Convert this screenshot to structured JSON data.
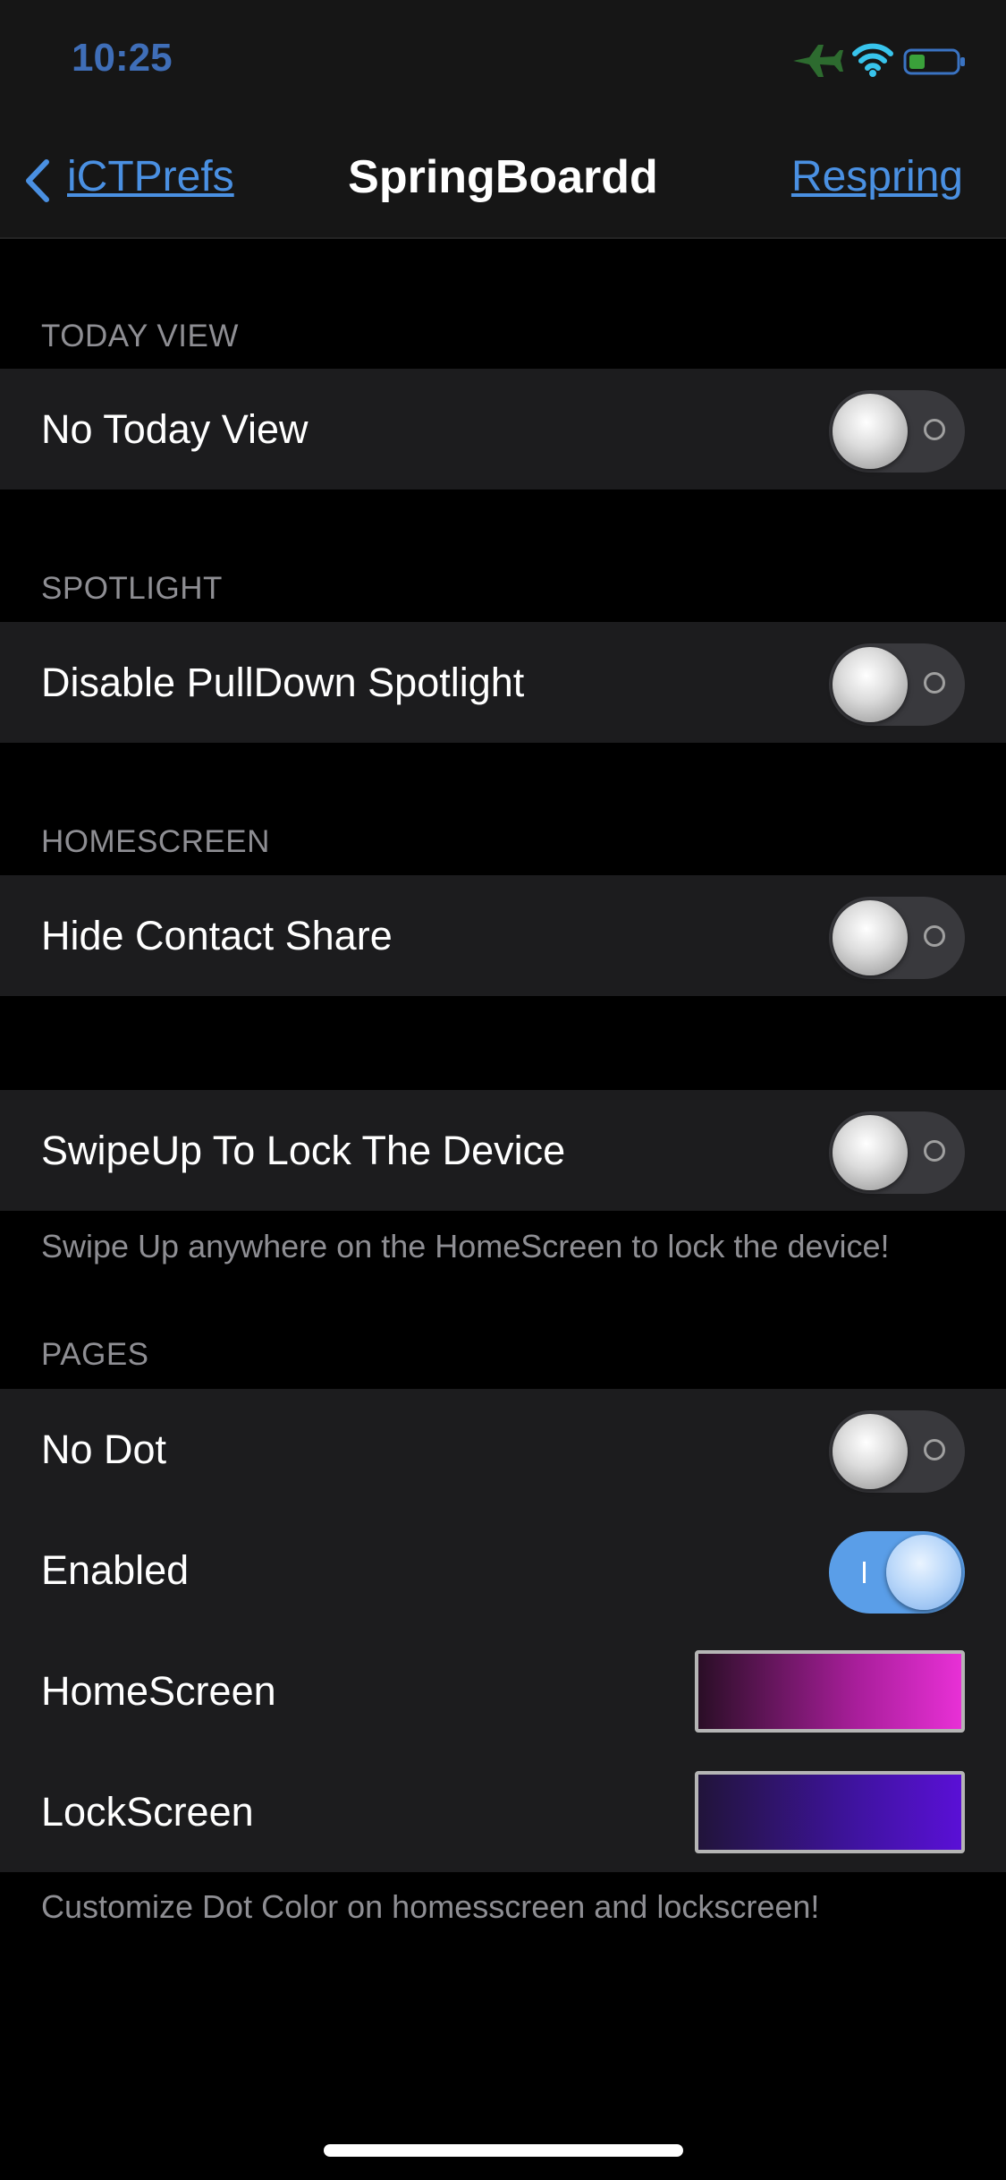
{
  "status_bar": {
    "time": "10:25",
    "icons": [
      "airplane-icon",
      "wifi-icon",
      "battery-icon"
    ]
  },
  "nav": {
    "back_label": "iCTPrefs",
    "title": "SpringBoardd",
    "action_label": "Respring"
  },
  "sections": {
    "today_view": {
      "header": "TODAY VIEW",
      "rows": [
        {
          "label": "No Today View",
          "on": false
        }
      ]
    },
    "spotlight": {
      "header": "SPOTLIGHT",
      "rows": [
        {
          "label": "Disable PullDown Spotlight",
          "on": false
        }
      ]
    },
    "homescreen": {
      "header": "HOMESCREEN",
      "rows": [
        {
          "label": "Hide Contact Share",
          "on": false
        }
      ]
    },
    "swipe": {
      "rows": [
        {
          "label": "SwipeUp To Lock The Device",
          "on": false
        }
      ],
      "footer": "Swipe Up anywhere on the HomeScreen to lock the device!"
    },
    "pages": {
      "header": "PAGES",
      "rows": [
        {
          "label": "No Dot",
          "on": false
        },
        {
          "label": "Enabled",
          "on": true
        }
      ],
      "colors": [
        {
          "label": "HomeScreen",
          "color_from": "#2a0e26",
          "color_to": "#e830d6"
        },
        {
          "label": "LockScreen",
          "color_from": "#21143a",
          "color_to": "#5a10d6"
        }
      ],
      "footer": "Customize Dot Color on homesscreen and lockscreen!"
    }
  },
  "colors": {
    "accent": "#4a90e2",
    "toggle_on": "#5a9ee8",
    "cell_bg": "#1c1c1e",
    "secondary_text": "#8e8e93"
  }
}
